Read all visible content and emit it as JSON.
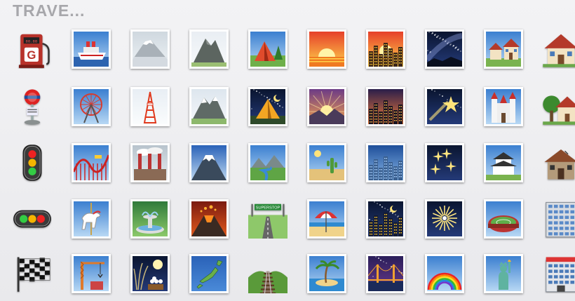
{
  "category": {
    "title": "TRAVE..."
  },
  "emoji_grid": {
    "rows": [
      [
        "fuel-pump",
        "ship",
        "mount-fuji-fog",
        "mountain",
        "tent",
        "sunrise",
        "city-sunset",
        "milky-way",
        "houses",
        "house"
      ],
      [
        "busstop",
        "ferris-wheel",
        "tokyo-tower",
        "snow-mountain",
        "camping-night",
        "sunrise-over-mountains",
        "city-dusk",
        "shooting-star",
        "european-castle",
        "house-with-garden"
      ],
      [
        "vertical-traffic-light",
        "roller-coaster",
        "factory",
        "mount-fuji",
        "national-park",
        "desert",
        "cityscape",
        "sparkler",
        "japanese-castle",
        "derelict-house"
      ],
      [
        "horizontal-traffic-light",
        "carousel-horse",
        "fountain",
        "volcano",
        "motorway",
        "beach-with-umbrella",
        "night-with-stars",
        "fireworks",
        "stadium",
        "office-building"
      ],
      [
        "chequered-flag",
        "building-construction",
        "moon-viewing-ceremony",
        "japan-map",
        "railway-track",
        "desert-island",
        "bridge-at-night",
        "rainbow",
        "statue-of-liberty",
        "department-store"
      ]
    ],
    "motorway_sign_text": "SUPERSTOP",
    "fuel_pump_letter": "G",
    "fuel_pump_display": "88.88"
  }
}
